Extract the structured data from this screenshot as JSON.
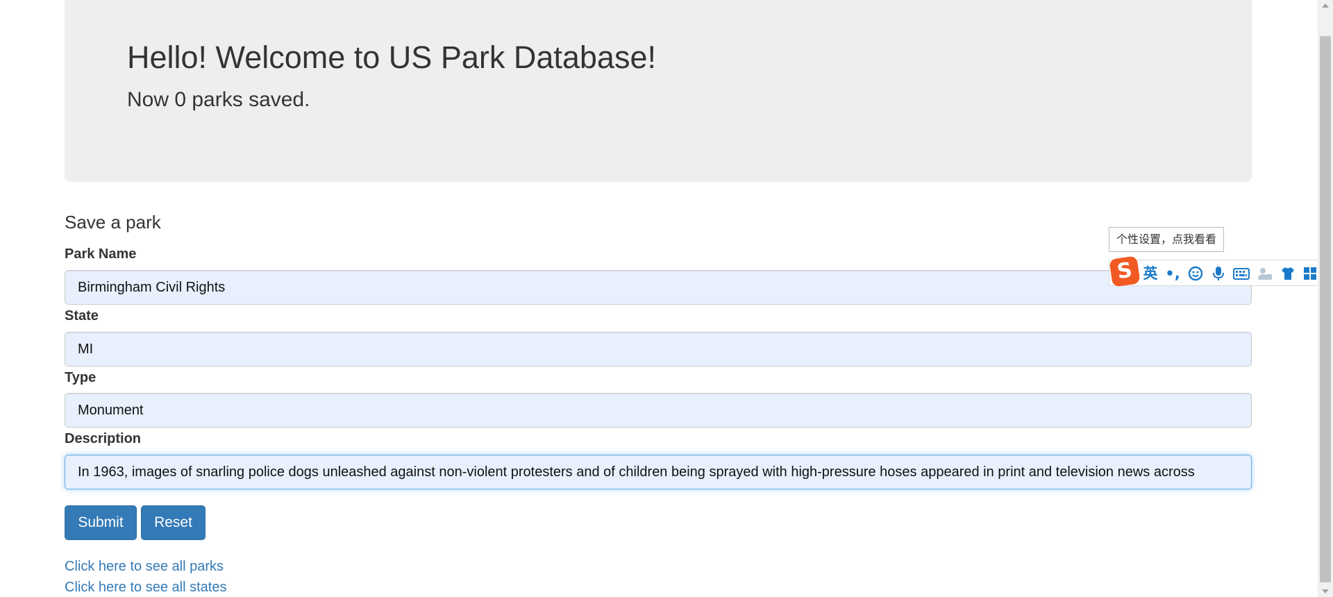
{
  "jumbotron": {
    "title": "Hello! Welcome to US Park Database!",
    "subtitle": "Now 0 parks saved."
  },
  "form": {
    "title": "Save a park",
    "fields": [
      {
        "label": "Park Name",
        "value": "Birmingham Civil Rights"
      },
      {
        "label": "State",
        "value": "MI"
      },
      {
        "label": "Type",
        "value": "Monument"
      },
      {
        "label": "Description",
        "value": "In 1963, images of snarling police dogs unleashed against non-violent protesters and of children being sprayed with high-pressure hoses appeared in print and television news across"
      }
    ],
    "submit_label": "Submit",
    "reset_label": "Reset"
  },
  "links": {
    "all_parks": "Click here to see all parks",
    "all_states": "Click here to see all states"
  },
  "ime": {
    "tooltip": "个性设置，点我看看",
    "logo": "S",
    "mode_label": "英",
    "punct_label": "•,",
    "icons": [
      "sogou-logo-icon",
      "chinese-english-toggle-icon",
      "punctuation-icon",
      "emoji-icon",
      "microphone-icon",
      "keyboard-icon",
      "user-icon",
      "skin-shirt-icon",
      "toolbox-grid-icon"
    ]
  },
  "colors": {
    "jumbotron_bg": "#eeeeee",
    "primary": "#337ab7",
    "link": "#337ab7",
    "input_bg": "#e8f0fe",
    "focus_border": "#66afe9",
    "ime_accent": "#1a7ac9",
    "ime_logo": "#f15a22"
  }
}
